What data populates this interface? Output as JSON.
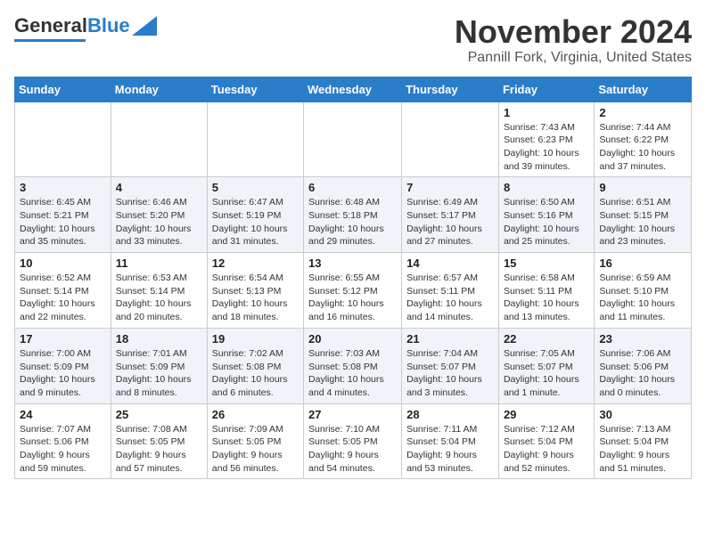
{
  "header": {
    "logo_general": "General",
    "logo_blue": "Blue",
    "month": "November 2024",
    "location": "Pannill Fork, Virginia, United States"
  },
  "days_of_week": [
    "Sunday",
    "Monday",
    "Tuesday",
    "Wednesday",
    "Thursday",
    "Friday",
    "Saturday"
  ],
  "weeks": [
    [
      {
        "day": "",
        "content": ""
      },
      {
        "day": "",
        "content": ""
      },
      {
        "day": "",
        "content": ""
      },
      {
        "day": "",
        "content": ""
      },
      {
        "day": "",
        "content": ""
      },
      {
        "day": "1",
        "content": "Sunrise: 7:43 AM\nSunset: 6:23 PM\nDaylight: 10 hours and 39 minutes."
      },
      {
        "day": "2",
        "content": "Sunrise: 7:44 AM\nSunset: 6:22 PM\nDaylight: 10 hours and 37 minutes."
      }
    ],
    [
      {
        "day": "3",
        "content": "Sunrise: 6:45 AM\nSunset: 5:21 PM\nDaylight: 10 hours and 35 minutes."
      },
      {
        "day": "4",
        "content": "Sunrise: 6:46 AM\nSunset: 5:20 PM\nDaylight: 10 hours and 33 minutes."
      },
      {
        "day": "5",
        "content": "Sunrise: 6:47 AM\nSunset: 5:19 PM\nDaylight: 10 hours and 31 minutes."
      },
      {
        "day": "6",
        "content": "Sunrise: 6:48 AM\nSunset: 5:18 PM\nDaylight: 10 hours and 29 minutes."
      },
      {
        "day": "7",
        "content": "Sunrise: 6:49 AM\nSunset: 5:17 PM\nDaylight: 10 hours and 27 minutes."
      },
      {
        "day": "8",
        "content": "Sunrise: 6:50 AM\nSunset: 5:16 PM\nDaylight: 10 hours and 25 minutes."
      },
      {
        "day": "9",
        "content": "Sunrise: 6:51 AM\nSunset: 5:15 PM\nDaylight: 10 hours and 23 minutes."
      }
    ],
    [
      {
        "day": "10",
        "content": "Sunrise: 6:52 AM\nSunset: 5:14 PM\nDaylight: 10 hours and 22 minutes."
      },
      {
        "day": "11",
        "content": "Sunrise: 6:53 AM\nSunset: 5:14 PM\nDaylight: 10 hours and 20 minutes."
      },
      {
        "day": "12",
        "content": "Sunrise: 6:54 AM\nSunset: 5:13 PM\nDaylight: 10 hours and 18 minutes."
      },
      {
        "day": "13",
        "content": "Sunrise: 6:55 AM\nSunset: 5:12 PM\nDaylight: 10 hours and 16 minutes."
      },
      {
        "day": "14",
        "content": "Sunrise: 6:57 AM\nSunset: 5:11 PM\nDaylight: 10 hours and 14 minutes."
      },
      {
        "day": "15",
        "content": "Sunrise: 6:58 AM\nSunset: 5:11 PM\nDaylight: 10 hours and 13 minutes."
      },
      {
        "day": "16",
        "content": "Sunrise: 6:59 AM\nSunset: 5:10 PM\nDaylight: 10 hours and 11 minutes."
      }
    ],
    [
      {
        "day": "17",
        "content": "Sunrise: 7:00 AM\nSunset: 5:09 PM\nDaylight: 10 hours and 9 minutes."
      },
      {
        "day": "18",
        "content": "Sunrise: 7:01 AM\nSunset: 5:09 PM\nDaylight: 10 hours and 8 minutes."
      },
      {
        "day": "19",
        "content": "Sunrise: 7:02 AM\nSunset: 5:08 PM\nDaylight: 10 hours and 6 minutes."
      },
      {
        "day": "20",
        "content": "Sunrise: 7:03 AM\nSunset: 5:08 PM\nDaylight: 10 hours and 4 minutes."
      },
      {
        "day": "21",
        "content": "Sunrise: 7:04 AM\nSunset: 5:07 PM\nDaylight: 10 hours and 3 minutes."
      },
      {
        "day": "22",
        "content": "Sunrise: 7:05 AM\nSunset: 5:07 PM\nDaylight: 10 hours and 1 minute."
      },
      {
        "day": "23",
        "content": "Sunrise: 7:06 AM\nSunset: 5:06 PM\nDaylight: 10 hours and 0 minutes."
      }
    ],
    [
      {
        "day": "24",
        "content": "Sunrise: 7:07 AM\nSunset: 5:06 PM\nDaylight: 9 hours and 59 minutes."
      },
      {
        "day": "25",
        "content": "Sunrise: 7:08 AM\nSunset: 5:05 PM\nDaylight: 9 hours and 57 minutes."
      },
      {
        "day": "26",
        "content": "Sunrise: 7:09 AM\nSunset: 5:05 PM\nDaylight: 9 hours and 56 minutes."
      },
      {
        "day": "27",
        "content": "Sunrise: 7:10 AM\nSunset: 5:05 PM\nDaylight: 9 hours and 54 minutes."
      },
      {
        "day": "28",
        "content": "Sunrise: 7:11 AM\nSunset: 5:04 PM\nDaylight: 9 hours and 53 minutes."
      },
      {
        "day": "29",
        "content": "Sunrise: 7:12 AM\nSunset: 5:04 PM\nDaylight: 9 hours and 52 minutes."
      },
      {
        "day": "30",
        "content": "Sunrise: 7:13 AM\nSunset: 5:04 PM\nDaylight: 9 hours and 51 minutes."
      }
    ]
  ]
}
